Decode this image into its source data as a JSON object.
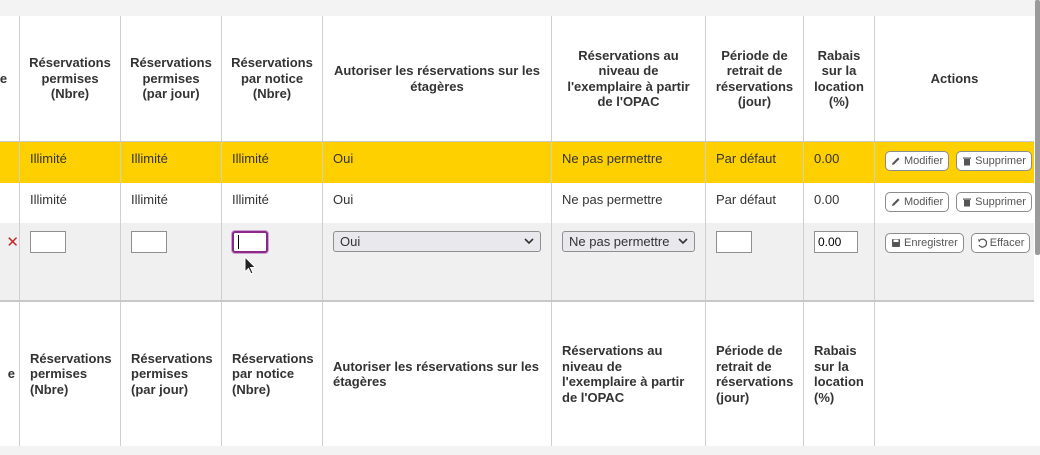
{
  "header": {
    "col0": "e",
    "holds_allowed": "Réservations permises (Nbre)",
    "holds_per_day": "Réservations permises (par jour)",
    "holds_per_record": "Réservations par notice (Nbre)",
    "on_shelf_holds": "Autoriser les réservations sur les étagères",
    "opac_item_level": "Réservations au niveau de l'exemplaire à partir de l'OPAC",
    "hold_pickup_period": "Période de retrait de réservations (jour)",
    "rental_discount": "Rabais sur la location (%)",
    "actions": "Actions"
  },
  "rows": [
    {
      "holds_allowed": "Illimité",
      "holds_per_day": "Illimité",
      "holds_per_record": "Illimité",
      "on_shelf_holds": "Oui",
      "opac_item_level": "Ne pas permettre",
      "hold_pickup_period": "Par défaut",
      "rental_discount": "0.00",
      "edit_label": "Modifier",
      "delete_label": "Supprimer"
    },
    {
      "holds_allowed": "Illimité",
      "holds_per_day": "Illimité",
      "holds_per_record": "Illimité",
      "on_shelf_holds": "Oui",
      "opac_item_level": "Ne pas permettre",
      "hold_pickup_period": "Par défaut",
      "rental_discount": "0.00",
      "edit_label": "Modifier",
      "delete_label": "Supprimer"
    }
  ],
  "edit_row": {
    "clear_mark": "✕",
    "on_shelf_select": "Oui",
    "opac_item_level_select": "Ne pas permettre",
    "rental_discount_value": "0.00",
    "save_label": "Enregistrer",
    "clear_label": "Effacer"
  },
  "footer": {
    "col0": "e",
    "holds_allowed": "Réservations permises (Nbre)",
    "holds_per_day": "Réservations permises (par jour)",
    "holds_per_record": "Réservations par notice (Nbre)",
    "on_shelf_holds": "Autoriser les réservations sur les étagères",
    "opac_item_level": "Réservations au niveau de l'exemplaire à partir de l'OPAC",
    "hold_pickup_period": "Période de retrait de réservations (jour)",
    "rental_discount": "Rabais sur la location (%)"
  },
  "colors": {
    "highlight_row": "#ffd000",
    "edit_row_bg": "#f0f0f0",
    "focus_ring": "#8a2a8a",
    "clear_mark": "#c62828"
  },
  "icons": [
    "pencil-icon",
    "trash-icon",
    "save-icon",
    "undo-icon",
    "mouse-pointer-icon"
  ]
}
